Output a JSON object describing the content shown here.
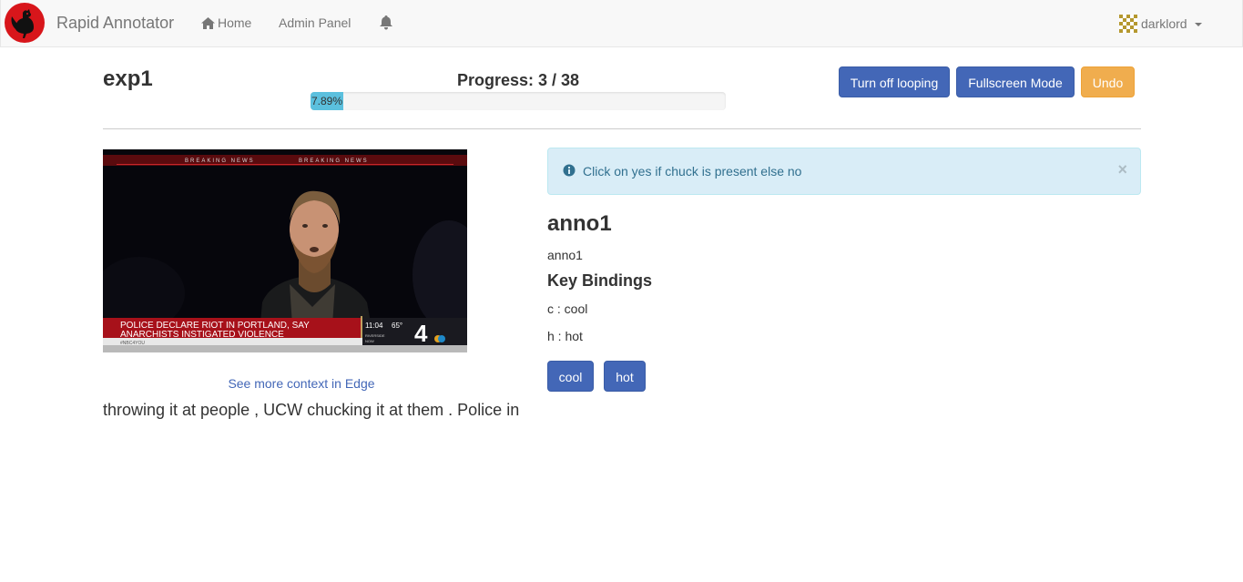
{
  "navbar": {
    "brand": "Rapid Annotator",
    "home": "Home",
    "admin": "Admin Panel",
    "user": "darklord",
    "icons": {
      "logo": "rooster-logo",
      "home": "home-icon",
      "bell": "bell-icon",
      "avatar": "identicon-avatar"
    }
  },
  "experiment": {
    "title": "exp1"
  },
  "progress": {
    "label": "Progress: 3 / 38",
    "current": 3,
    "total": 38,
    "percent_text": "7.89%",
    "percent": 7.89
  },
  "toolbar": {
    "loop": "Turn off looping",
    "fullscreen": "Fullscreen Mode",
    "undo": "Undo"
  },
  "video": {
    "banner": "BREAKING NEWS",
    "headline_1": "POLICE DECLARE RIOT IN PORTLAND, SAY",
    "headline_2": "ANARCHISTS INSTIGATED VIOLENCE",
    "time": "11:04",
    "temp": "65°",
    "place_1": "RIVERSIDE",
    "place_2": "NOW",
    "channel": "4",
    "handle": "#NBC4YOU"
  },
  "context_link": "See more context in Edge",
  "transcript": "throwing it at people , UCW chucking it at them . Police in",
  "alert": {
    "text": "Click on yes if chuck is present else no",
    "close": "×"
  },
  "annotation": {
    "title": "anno1",
    "description": "anno1",
    "key_bindings_title": "Key Bindings",
    "bindings": [
      "c : cool",
      "h : hot"
    ],
    "buttons": [
      "cool",
      "hot"
    ]
  },
  "colors": {
    "primary": "#4367b7",
    "warning": "#f0ad4e",
    "info_bg": "#d9edf7",
    "progress": "#5bc0de"
  }
}
